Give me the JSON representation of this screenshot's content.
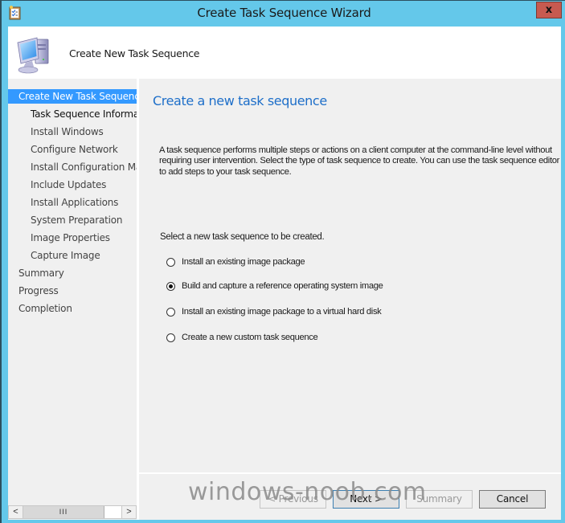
{
  "window": {
    "title": "Create Task Sequence Wizard",
    "close_label": "x",
    "title_icon": "task-sequence-icon"
  },
  "header": {
    "title": "Create New Task Sequence",
    "icon": "computer-icon"
  },
  "sidebar": {
    "items": [
      {
        "label": "Create New Task Sequence",
        "level": 1,
        "state": "selected"
      },
      {
        "label": "Task Sequence Information",
        "level": 2,
        "state": "current"
      },
      {
        "label": "Install Windows",
        "level": 2,
        "state": "pending"
      },
      {
        "label": "Configure Network",
        "level": 2,
        "state": "pending"
      },
      {
        "label": "Install Configuration Manager",
        "level": 2,
        "state": "pending"
      },
      {
        "label": "Include Updates",
        "level": 2,
        "state": "pending"
      },
      {
        "label": "Install Applications",
        "level": 2,
        "state": "pending"
      },
      {
        "label": "System Preparation",
        "level": 2,
        "state": "pending"
      },
      {
        "label": "Image Properties",
        "level": 2,
        "state": "pending"
      },
      {
        "label": "Capture Image",
        "level": 2,
        "state": "pending"
      },
      {
        "label": "Summary",
        "level": 1,
        "state": "pending"
      },
      {
        "label": "Progress",
        "level": 1,
        "state": "pending"
      },
      {
        "label": "Completion",
        "level": 1,
        "state": "pending"
      }
    ],
    "scrollbar": {
      "left_arrow": "<",
      "right_arrow": ">",
      "thumb_grip": "III"
    }
  },
  "content": {
    "title": "Create a new task sequence",
    "description": "A task sequence performs multiple steps or actions on a client computer at the command-line level without requiring user intervention. Select the type of task sequence to create. You can use the task sequence editor to add steps to your task sequence.",
    "select_label": "Select a new task sequence to be created.",
    "options": [
      {
        "label": "Install an existing image package",
        "checked": false
      },
      {
        "label": "Build and capture a reference operating system image",
        "checked": true
      },
      {
        "label": "Install an existing image package to a virtual hard disk",
        "checked": false
      },
      {
        "label": "Create a new custom task sequence",
        "checked": false
      }
    ]
  },
  "footer": {
    "previous_label": "< Previous",
    "next_label": "Next >",
    "summary_label": "Summary",
    "cancel_label": "Cancel"
  },
  "watermark": "windows-noob.com",
  "colors": {
    "frame": "#64c8ea",
    "close": "#c75a50",
    "selection": "#3399ff",
    "title_blue": "#1e6fc9"
  }
}
